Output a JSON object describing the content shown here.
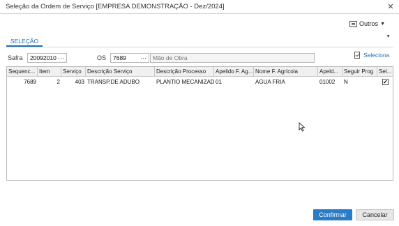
{
  "window": {
    "title": "Seleção da Ordem de Serviço [EMPRESA DEMONSTRAÇÃO - Dez/2024]",
    "close_glyph": "✕"
  },
  "toolbar": {
    "outros_label": "Outros",
    "outros_icon": "menu-list-icon"
  },
  "tab": {
    "label": "SELEÇÃO"
  },
  "filters": {
    "safra_label": "Safra",
    "safra_value": "20092010",
    "os_label": "OS",
    "os_value": "7689",
    "os_description": "Mão de Obra",
    "lookup_glyph": "···"
  },
  "seleciona_label": "Seleciona",
  "grid": {
    "columns": [
      "Sequenc...",
      "Item",
      "Serviço",
      "Descrição Serviço",
      "Descrição Processo",
      "Apelido F. Ag...",
      "Nome F. Agrícola",
      "Apeld...",
      "Seguir Prog",
      "Sel..."
    ],
    "rows": [
      {
        "sequencia": "7689",
        "item": "2",
        "servico": "403",
        "descricao_servico": "TRANSP.DE ADUBO",
        "descricao_processo": "PLANTIO MECANIZADO",
        "apelido_fag": "01",
        "nome_fagricola": "AGUA FRIA",
        "apelido": "01002",
        "seguir_prog": "N",
        "selected": "✔"
      }
    ]
  },
  "buttons": {
    "confirm": "Confirmar",
    "cancel": "Cancelar"
  },
  "colors": {
    "accent": "#2a7cc7",
    "tab_accent": "#1f6fb2"
  }
}
